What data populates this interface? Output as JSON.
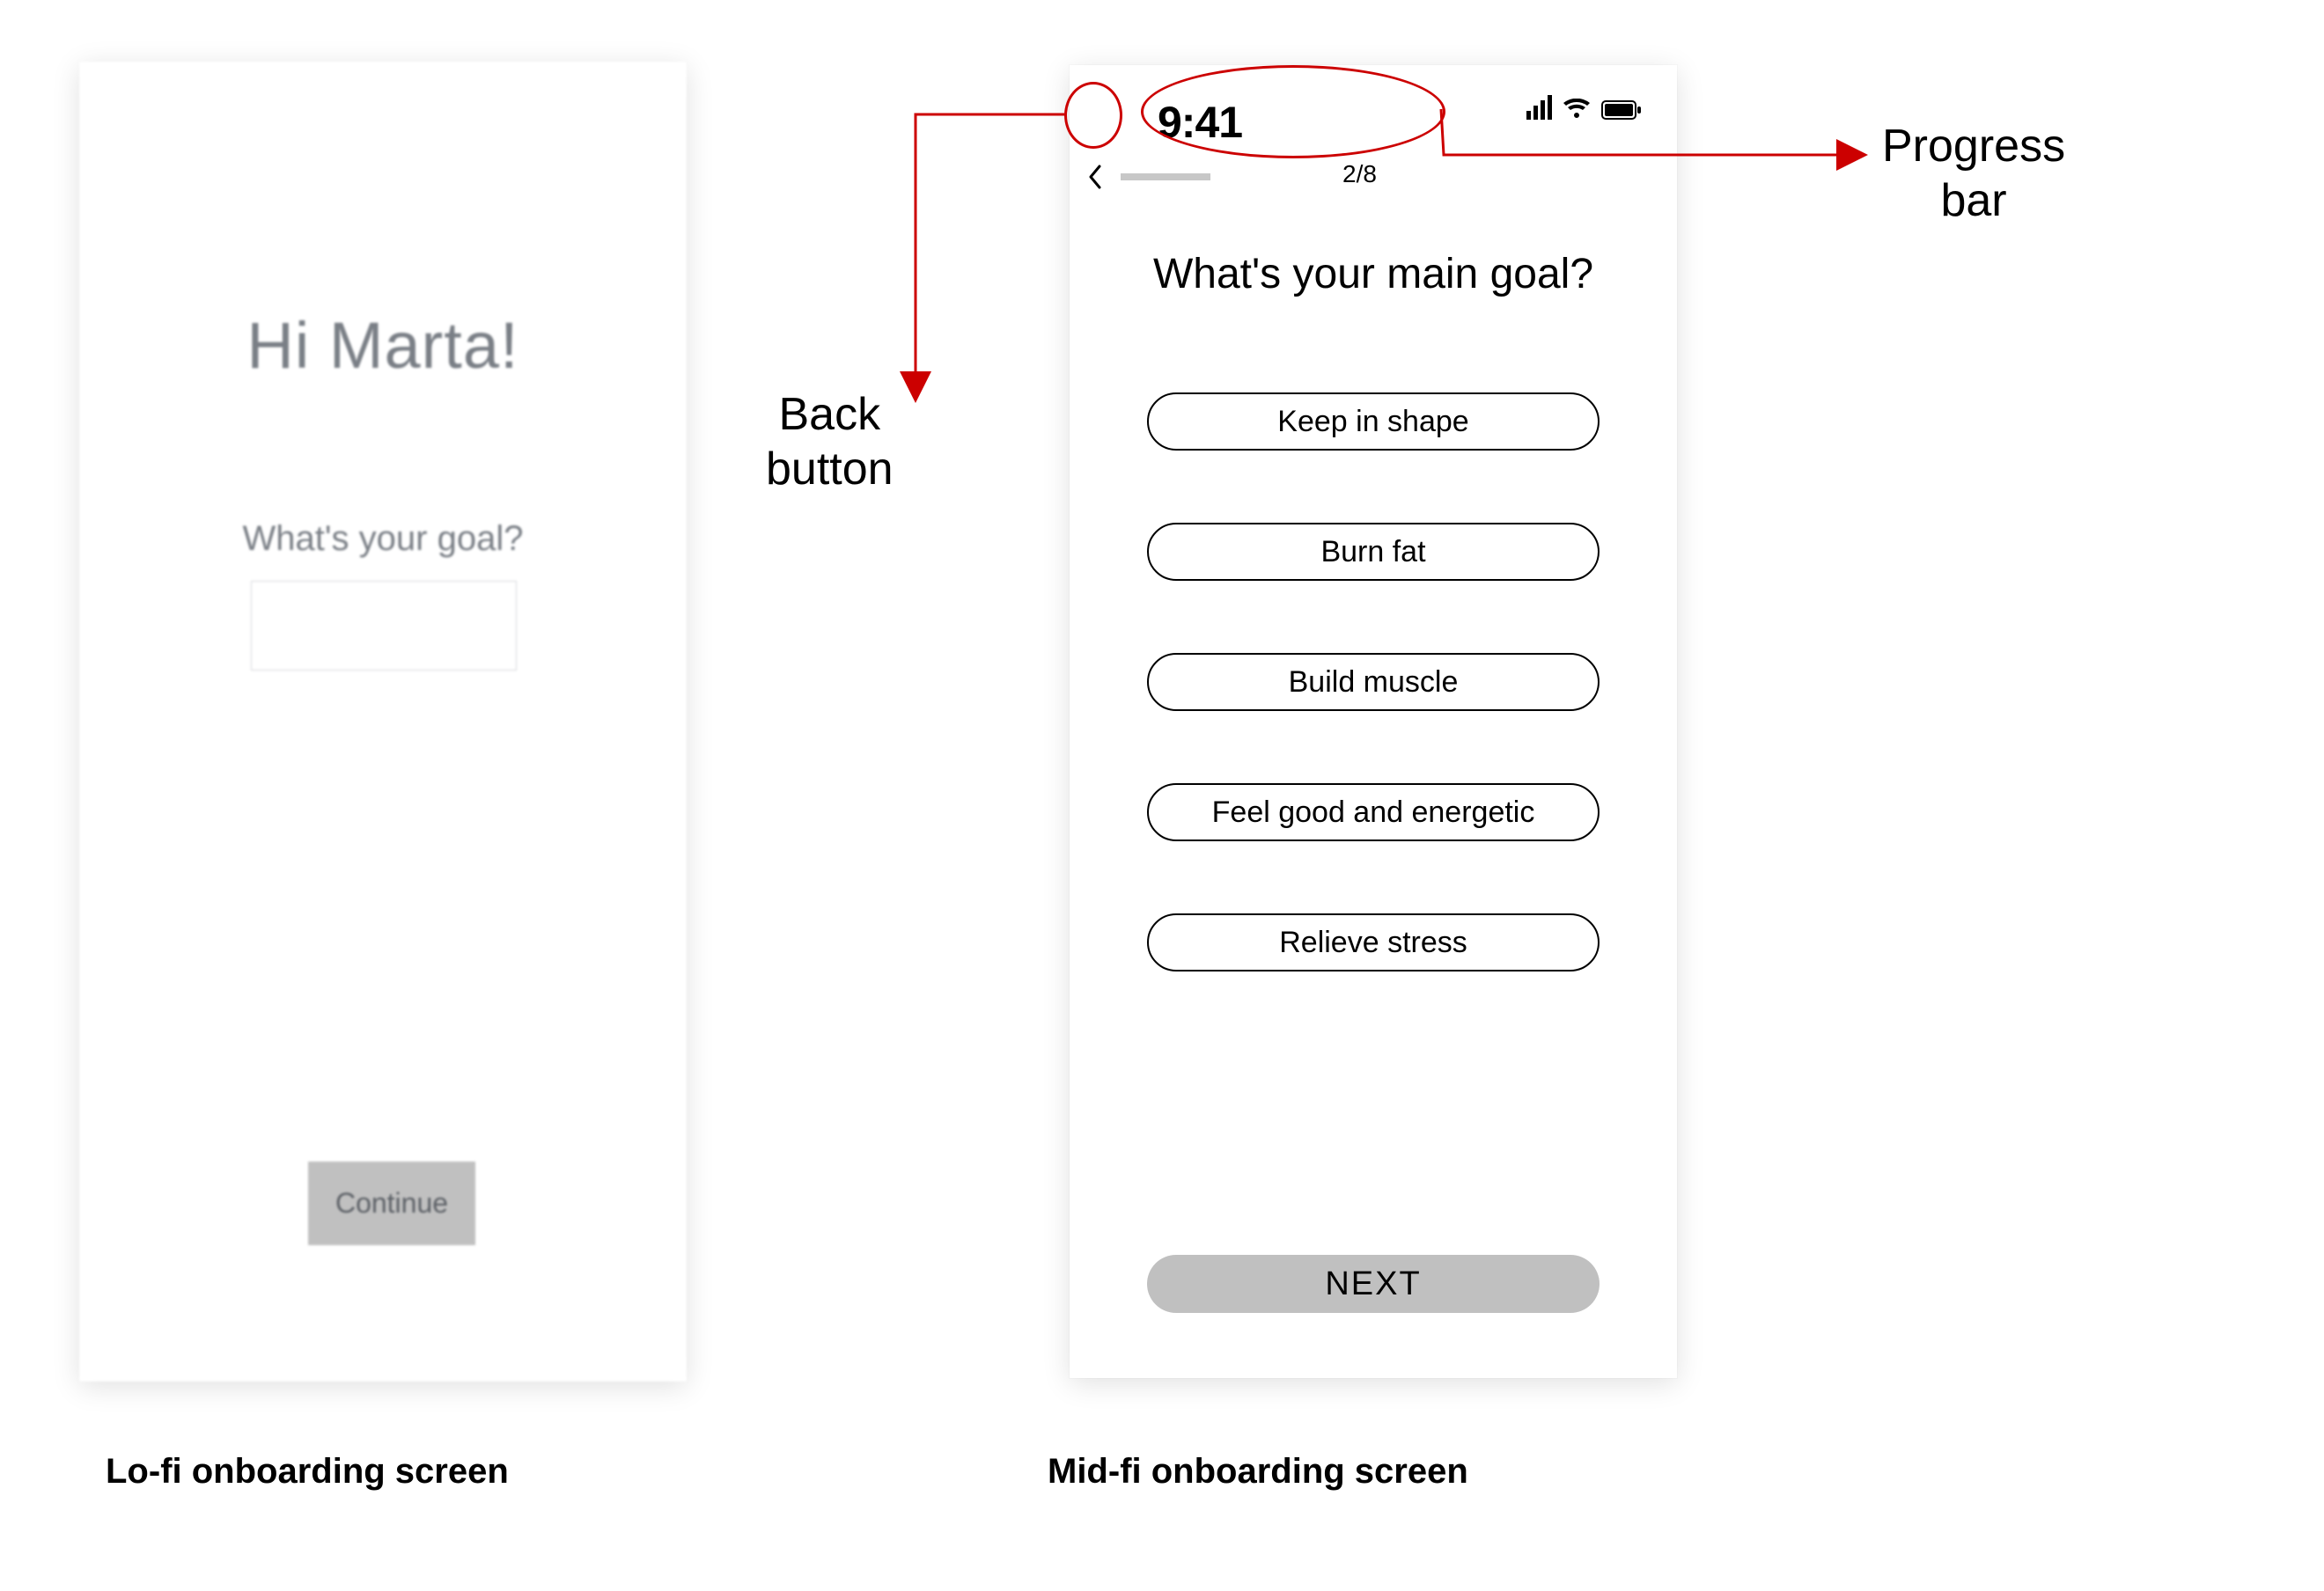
{
  "lofi": {
    "greeting": "Hi Marta!",
    "question": "What's your goal?",
    "continue": "Continue",
    "caption": "Lo-fi onboarding screen"
  },
  "midfi": {
    "caption": "Mid-fi onboarding screen",
    "clock": "9:41",
    "step": "2/8",
    "title": "What's your main goal?",
    "options": [
      "Keep in shape",
      "Burn fat",
      "Build muscle",
      "Feel good and energetic",
      "Relieve stress"
    ],
    "next": "NEXT",
    "progress": {
      "current": 2,
      "total": 8
    }
  },
  "annotations": {
    "back_button_l1": "Back",
    "back_button_l2": "button",
    "progress_bar_l1": "Progress",
    "progress_bar_l2": "bar",
    "red": "#cc0000"
  }
}
